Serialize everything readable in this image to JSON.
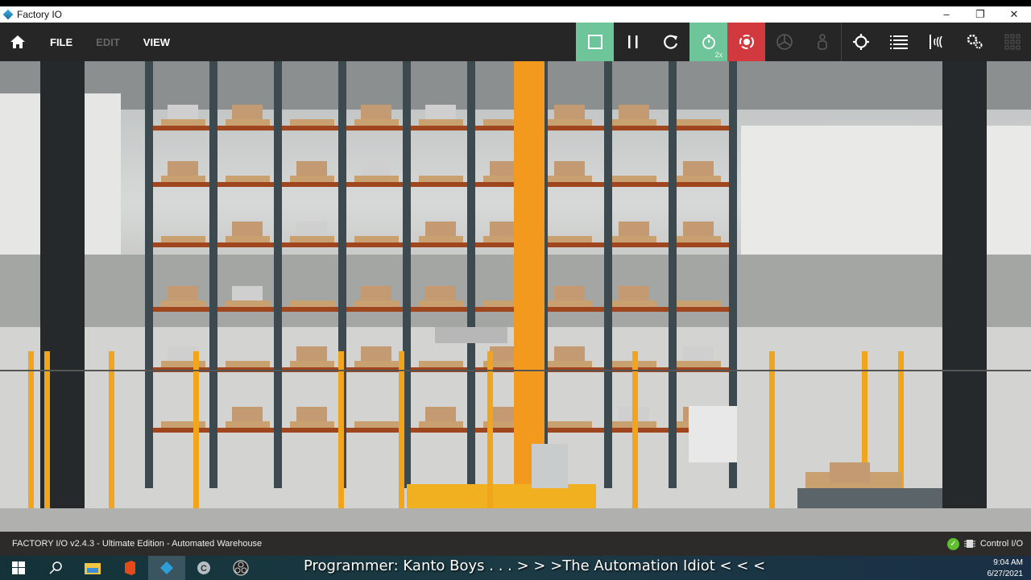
{
  "window": {
    "title": "Factory IO",
    "controls": [
      "–",
      "❐",
      "✕"
    ]
  },
  "menu": {
    "file": "FILE",
    "edit": "EDIT",
    "view": "VIEW"
  },
  "toolbar": {
    "speed_badge": "2x",
    "colors": {
      "green": "#6fc59a",
      "red": "#d2393e"
    }
  },
  "status": {
    "left": "FACTORY I/O v2.4.3 - Ultimate Edition - Automated Warehouse",
    "driver": "Control I/O"
  },
  "taskbar": {
    "caption": "Programmer: Kanto Boys . . .  > > >The Automation Idiot < < <",
    "time": "9:04 AM",
    "date": "6/27/2021"
  }
}
